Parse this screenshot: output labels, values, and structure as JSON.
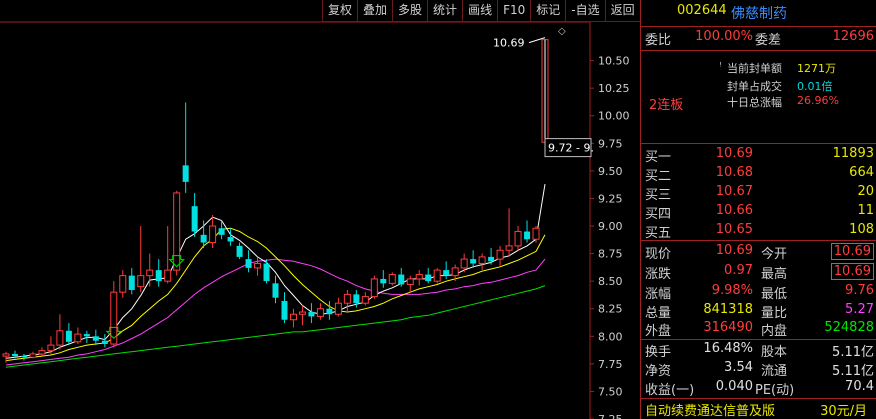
{
  "toolbar": {
    "buttons": [
      "复权",
      "叠加",
      "多股",
      "统计",
      "画线",
      "F10",
      "标记",
      "-自选",
      "返回"
    ]
  },
  "chart": {
    "ymin": 7.25,
    "ymax": 10.85,
    "yticks": [
      "10.50",
      "10.25",
      "10.00",
      "9.75",
      "9.50",
      "9.25",
      "9.00",
      "8.75",
      "8.50",
      "8.25",
      "8.00",
      "7.75",
      "7.50",
      "7.25"
    ],
    "high_label": "10.69",
    "box_label": "9.72 - 9.",
    "colors": {
      "up": "#ff3c3c",
      "down": "#00e0e0",
      "ma5": "#ffffff",
      "ma10": "#ffff00",
      "ma20": "#ff40ff",
      "ma60": "#00e000"
    }
  },
  "chart_data": {
    "type": "candlestick",
    "candles": [
      [
        7.82,
        7.86,
        7.76,
        7.84
      ],
      [
        7.84,
        7.87,
        7.8,
        7.82
      ],
      [
        7.82,
        7.84,
        7.78,
        7.81
      ],
      [
        7.81,
        7.86,
        7.8,
        7.84
      ],
      [
        7.84,
        7.9,
        7.82,
        7.87
      ],
      [
        7.87,
        8.0,
        7.84,
        7.92
      ],
      [
        7.92,
        8.2,
        7.88,
        8.05
      ],
      [
        8.05,
        8.12,
        7.92,
        7.95
      ],
      [
        7.95,
        8.08,
        7.93,
        8.02
      ],
      [
        8.02,
        8.05,
        7.94,
        8.0
      ],
      [
        8.0,
        8.06,
        7.92,
        7.96
      ],
      [
        7.96,
        8.02,
        7.9,
        7.93
      ],
      [
        7.93,
        8.5,
        7.9,
        8.4
      ],
      [
        8.4,
        8.6,
        8.35,
        8.55
      ],
      [
        8.55,
        8.62,
        8.38,
        8.42
      ],
      [
        8.45,
        9.0,
        8.4,
        8.55
      ],
      [
        8.55,
        8.75,
        8.45,
        8.6
      ],
      [
        8.6,
        8.7,
        8.45,
        8.5
      ],
      [
        8.5,
        9.0,
        8.48,
        8.6
      ],
      [
        8.6,
        9.32,
        8.55,
        9.3
      ],
      [
        9.55,
        10.12,
        9.3,
        9.4
      ],
      [
        9.18,
        9.3,
        8.9,
        8.95
      ],
      [
        8.92,
        9.05,
        8.8,
        8.85
      ],
      [
        8.85,
        9.1,
        8.8,
        9.0
      ],
      [
        8.98,
        9.05,
        8.88,
        8.92
      ],
      [
        8.9,
        8.98,
        8.82,
        8.86
      ],
      [
        8.82,
        8.85,
        8.7,
        8.72
      ],
      [
        8.7,
        8.78,
        8.58,
        8.62
      ],
      [
        8.62,
        8.72,
        8.55,
        8.66
      ],
      [
        8.66,
        8.7,
        8.48,
        8.5
      ],
      [
        8.48,
        8.55,
        8.3,
        8.35
      ],
      [
        8.32,
        8.4,
        8.12,
        8.15
      ],
      [
        8.15,
        8.25,
        8.08,
        8.2
      ],
      [
        8.2,
        8.28,
        8.1,
        8.22
      ],
      [
        8.22,
        8.3,
        8.12,
        8.18
      ],
      [
        8.18,
        8.3,
        8.15,
        8.25
      ],
      [
        8.25,
        8.32,
        8.15,
        8.2
      ],
      [
        8.2,
        8.35,
        8.18,
        8.3
      ],
      [
        8.3,
        8.42,
        8.22,
        8.38
      ],
      [
        8.38,
        8.42,
        8.26,
        8.3
      ],
      [
        8.3,
        8.4,
        8.28,
        8.36
      ],
      [
        8.36,
        8.55,
        8.34,
        8.52
      ],
      [
        8.52,
        8.6,
        8.44,
        8.48
      ],
      [
        8.48,
        8.58,
        8.46,
        8.56
      ],
      [
        8.56,
        8.62,
        8.45,
        8.47
      ],
      [
        8.47,
        8.55,
        8.4,
        8.52
      ],
      [
        8.52,
        8.6,
        8.46,
        8.56
      ],
      [
        8.56,
        8.62,
        8.48,
        8.5
      ],
      [
        8.5,
        8.62,
        8.48,
        8.6
      ],
      [
        8.6,
        8.68,
        8.52,
        8.55
      ],
      [
        8.55,
        8.65,
        8.5,
        8.62
      ],
      [
        8.62,
        8.75,
        8.58,
        8.7
      ],
      [
        8.7,
        8.78,
        8.62,
        8.66
      ],
      [
        8.66,
        8.75,
        8.6,
        8.72
      ],
      [
        8.72,
        8.8,
        8.65,
        8.68
      ],
      [
        8.7,
        8.82,
        8.64,
        8.78
      ],
      [
        8.78,
        9.16,
        8.72,
        8.82
      ],
      [
        8.82,
        9.0,
        8.78,
        8.95
      ],
      [
        8.95,
        9.05,
        8.85,
        8.88
      ],
      [
        8.88,
        9.0,
        8.85,
        8.98
      ],
      [
        9.76,
        10.69,
        9.72,
        10.69
      ]
    ],
    "ma5": [
      7.8,
      7.81,
      7.82,
      7.83,
      7.84,
      7.86,
      7.9,
      7.93,
      7.96,
      7.99,
      7.99,
      7.97,
      8.06,
      8.17,
      8.25,
      8.37,
      8.51,
      8.52,
      8.53,
      8.71,
      8.88,
      8.93,
      9.0,
      9.08,
      9.05,
      8.92,
      8.87,
      8.8,
      8.72,
      8.67,
      8.58,
      8.46,
      8.37,
      8.28,
      8.22,
      8.2,
      8.21,
      8.23,
      8.27,
      8.29,
      8.31,
      8.37,
      8.41,
      8.44,
      8.48,
      8.52,
      8.52,
      8.52,
      8.55,
      8.55,
      8.56,
      8.6,
      8.63,
      8.65,
      8.67,
      8.71,
      8.73,
      8.78,
      8.82,
      8.88,
      9.38
    ],
    "ma10": [
      7.78,
      7.79,
      7.8,
      7.81,
      7.82,
      7.83,
      7.85,
      7.88,
      7.9,
      7.92,
      7.93,
      7.94,
      7.98,
      8.05,
      8.1,
      8.18,
      8.25,
      8.32,
      8.38,
      8.48,
      8.6,
      8.72,
      8.82,
      8.88,
      8.97,
      8.98,
      8.95,
      8.9,
      8.86,
      8.8,
      8.72,
      8.64,
      8.55,
      8.47,
      8.4,
      8.33,
      8.27,
      8.23,
      8.22,
      8.23,
      8.25,
      8.27,
      8.3,
      8.34,
      8.37,
      8.4,
      8.43,
      8.45,
      8.47,
      8.5,
      8.52,
      8.54,
      8.56,
      8.59,
      8.61,
      8.63,
      8.66,
      8.69,
      8.73,
      8.77,
      8.92
    ],
    "ma20": [
      7.74,
      7.75,
      7.76,
      7.77,
      7.78,
      7.79,
      7.8,
      7.81,
      7.83,
      7.84,
      7.86,
      7.88,
      7.91,
      7.94,
      7.98,
      8.02,
      8.07,
      8.12,
      8.17,
      8.24,
      8.31,
      8.38,
      8.44,
      8.49,
      8.54,
      8.58,
      8.62,
      8.66,
      8.68,
      8.69,
      8.7,
      8.69,
      8.68,
      8.66,
      8.64,
      8.61,
      8.57,
      8.53,
      8.5,
      8.46,
      8.43,
      8.41,
      8.39,
      8.38,
      8.38,
      8.38,
      8.38,
      8.39,
      8.4,
      8.42,
      8.43,
      8.45,
      8.46,
      8.48,
      8.49,
      8.51,
      8.53,
      8.55,
      8.58,
      8.6,
      8.7
    ],
    "ma60": [
      7.72,
      7.73,
      7.74,
      7.75,
      7.76,
      7.77,
      7.78,
      7.79,
      7.8,
      7.81,
      7.82,
      7.83,
      7.84,
      7.85,
      7.86,
      7.87,
      7.88,
      7.89,
      7.9,
      7.91,
      7.92,
      7.93,
      7.94,
      7.95,
      7.96,
      7.97,
      7.98,
      7.99,
      8.0,
      8.01,
      8.02,
      8.03,
      8.04,
      8.04,
      8.05,
      8.06,
      8.07,
      8.08,
      8.09,
      8.1,
      8.11,
      8.12,
      8.13,
      8.14,
      8.15,
      8.17,
      8.18,
      8.19,
      8.21,
      8.23,
      8.25,
      8.27,
      8.29,
      8.31,
      8.33,
      8.35,
      8.37,
      8.39,
      8.41,
      8.43,
      8.46
    ],
    "arrows_at": [
      12,
      19
    ]
  },
  "panel": {
    "code": "002644",
    "name": "佛慈制药",
    "weibi_label": "委比",
    "weibi_value": "100.00%",
    "weicha_label": "委差",
    "weicha_value": "12696",
    "seal_amount_label": "当前封单额",
    "seal_amount_value": "1271万",
    "seal_ratio_label": "封单占成交",
    "seal_ratio_value": "0.01倍",
    "ten_day_label": "十日总涨幅",
    "ten_day_value": "26.96%",
    "streak": "2连板",
    "bids": [
      {
        "label": "买一",
        "price": "10.69",
        "vol": "11893"
      },
      {
        "label": "买二",
        "price": "10.68",
        "vol": "664"
      },
      {
        "label": "买三",
        "price": "10.67",
        "vol": "20"
      },
      {
        "label": "买四",
        "price": "10.66",
        "vol": "11"
      },
      {
        "label": "买五",
        "price": "10.65",
        "vol": "108"
      }
    ],
    "quote": {
      "now_label": "现价",
      "now_value": "10.69",
      "open_label": "今开",
      "open_value": "10.69",
      "chg_label": "涨跌",
      "chg_value": "0.97",
      "high_label": "最高",
      "high_value": "10.69",
      "pct_label": "涨幅",
      "pct_value": "9.98%",
      "low_label": "最低",
      "low_value": "9.76",
      "vol_label": "总量",
      "vol_value": "841318",
      "vr_label": "量比",
      "vr_value": "5.27",
      "outer_label": "外盘",
      "outer_value": "316490",
      "inner_label": "内盘",
      "inner_value": "524828",
      "turn_label": "换手",
      "turn_value": "16.48%",
      "cap_label": "股本",
      "cap_value": "5.11亿",
      "nav_label": "净资",
      "nav_value": "3.54",
      "float_label": "流通",
      "float_value": "5.11亿",
      "eps_label": "收益(一)",
      "eps_value": "0.040",
      "pe_label": "PE(动)",
      "pe_value": "70.4"
    },
    "footer_text": "自动续费通达信普及版",
    "footer_price": "30元/月"
  }
}
